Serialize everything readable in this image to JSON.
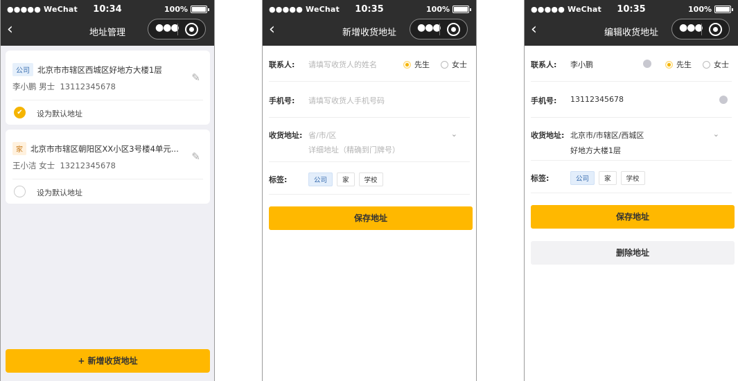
{
  "status": {
    "carrier": "●●●●● WeChat",
    "battery": "100%"
  },
  "screens": [
    {
      "time": "10:34",
      "title": "地址管理",
      "addresses": [
        {
          "tag": "公司",
          "address": "北京市市辖区西城区好地方大楼1层",
          "person": "李小鹏 男士",
          "phone": "13112345678",
          "default_label": "设为默认地址",
          "is_default": true
        },
        {
          "tag": "家",
          "address": "北京市市辖区朝阳区XX小区3号楼4单元...",
          "person": "王小洁 女士",
          "phone": "13212345678",
          "default_label": "设为默认地址",
          "is_default": false
        }
      ],
      "add_button": "+ 新增收货地址"
    },
    {
      "time": "10:35",
      "title": "新增收货地址",
      "contact_label": "联系人:",
      "contact_placeholder": "请填写收货人的姓名",
      "gender_options": [
        "先生",
        "女士"
      ],
      "phone_label": "手机号:",
      "phone_placeholder": "请填写收货人手机号码",
      "region_label": "收货地址:",
      "region_placeholder": "省/市/区",
      "detail_placeholder": "详细地址（精确到门牌号）",
      "tags_label": "标签:",
      "tags": [
        "公司",
        "家",
        "学校"
      ],
      "save_button": "保存地址"
    },
    {
      "time": "10:35",
      "title": "编辑收货地址",
      "contact_label": "联系人:",
      "contact_value": "李小鹏",
      "gender_options": [
        "先生",
        "女士"
      ],
      "phone_label": "手机号:",
      "phone_value": "13112345678",
      "region_label": "收货地址:",
      "region_value": "北京市/市辖区/西城区",
      "detail_value": "好地方大楼1层",
      "tags_label": "标签:",
      "tags": [
        "公司",
        "家",
        "学校"
      ],
      "save_button": "保存地址",
      "delete_button": "删除地址"
    }
  ],
  "icons": {
    "back": "chevron-left-icon",
    "more": "more-dots-icon",
    "close": "target-circle-icon",
    "edit": "pencil-icon",
    "check": "check-icon",
    "chevron": "chevron-down-icon",
    "clear": "clear-dot-icon"
  },
  "colors": {
    "accent": "#ffb800",
    "topbar": "#2e2e2e",
    "tag_blue": "#3b6fb0"
  }
}
